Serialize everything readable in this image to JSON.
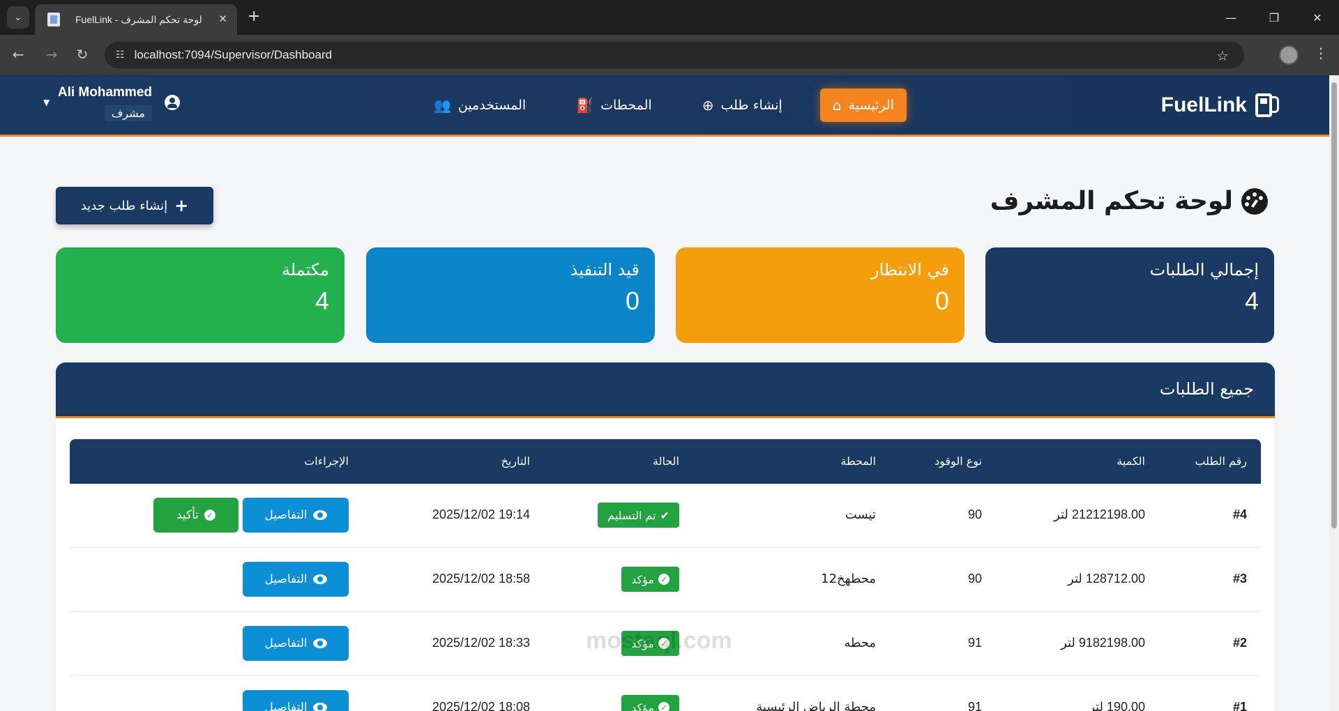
{
  "browser": {
    "tab_title": "FuelLink - لوحة تحكم المشرف",
    "url": "localhost:7094/Supervisor/Dashboard"
  },
  "navbar": {
    "brand": "FuelLink",
    "menu": [
      {
        "label": "الرئيسية",
        "icon": "home-icon",
        "active": true
      },
      {
        "label": "إنشاء طلب",
        "icon": "plus-circle-icon",
        "active": false
      },
      {
        "label": "المحطات",
        "icon": "gas-pump-icon",
        "active": false
      },
      {
        "label": "المستخدمين",
        "icon": "users-icon",
        "active": false
      }
    ],
    "user": {
      "name": "Ali Mohammed",
      "role": "مشرف"
    }
  },
  "page": {
    "title": "لوحة تحكم المشرف",
    "new_order_button": "إنشاء طلب جديد"
  },
  "stats": [
    {
      "label": "إجمالي الطلبات",
      "value": "4",
      "color": "#1b3a63"
    },
    {
      "label": "في الانتظار",
      "value": "0",
      "color": "#f59e0b"
    },
    {
      "label": "قيد التنفيذ",
      "value": "0",
      "color": "#0a85c9"
    },
    {
      "label": "مكتملة",
      "value": "4",
      "color": "#22b14c"
    }
  ],
  "orders": {
    "title": "جميع الطلبات",
    "columns": [
      "رقم الطلب",
      "الكمية",
      "نوع الوقود",
      "المحطة",
      "الحالة",
      "التاريخ",
      "الإجراءات"
    ],
    "rows": [
      {
        "id": "#4",
        "quantity": "21212198.00 لتر",
        "fuel": "90",
        "station": "تيست",
        "status": "تم التسليم",
        "date": "2025/12/02 19:14",
        "details": "التفاصيل",
        "confirm": "تأكيد"
      },
      {
        "id": "#3",
        "quantity": "128712.00 لتر",
        "fuel": "90",
        "station": "محطهخ12",
        "status": "مؤكد",
        "date": "2025/12/02 18:58",
        "details": "التفاصيل"
      },
      {
        "id": "#2",
        "quantity": "9182198.00 لتر",
        "fuel": "91",
        "station": "محطه",
        "status": "مؤكد",
        "date": "2025/12/02 18:33",
        "details": "التفاصيل"
      },
      {
        "id": "#1",
        "quantity": "190.00 لتر",
        "fuel": "91",
        "station": "محطة الرياض الرئيسية",
        "status": "مؤكد",
        "date": "2025/12/02 18:08",
        "details": "التفاصيل"
      }
    ]
  },
  "watermark": "mostaql.com"
}
